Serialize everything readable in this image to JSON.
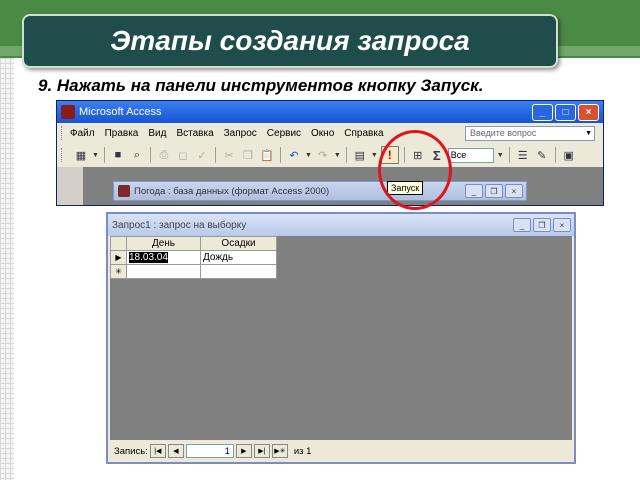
{
  "slide": {
    "title": "Этапы создания запроса",
    "instruction": "9. Нажать на панели инструментов кнопку Запуск."
  },
  "access_window": {
    "title": "Microsoft Access",
    "menu": [
      "Файл",
      "Правка",
      "Вид",
      "Вставка",
      "Запрос",
      "Сервис",
      "Окно",
      "Справка"
    ],
    "ask_placeholder": "Введите вопрос",
    "top_values_value": "Все",
    "run_tooltip": "Запуск",
    "run_button_glyph": "!",
    "sum_glyph": "Σ",
    "child_window_title": "Погода : база данных (формат Access 2000)"
  },
  "query_window": {
    "title": "Запрос1 : запрос на выборку",
    "columns": [
      "День",
      "Осадки"
    ],
    "rows": [
      {
        "marker": "▶",
        "day": "18.03.04",
        "precipitation": "Дождь"
      },
      {
        "marker": "✳",
        "day": "",
        "precipitation": ""
      }
    ],
    "nav_label": "Запись:",
    "current_record": "1",
    "of_label": "из 1"
  },
  "colors": {
    "title_bg": "#1f4d4c",
    "annotation_circle": "#e0141a",
    "run_icon": "#d60000"
  }
}
